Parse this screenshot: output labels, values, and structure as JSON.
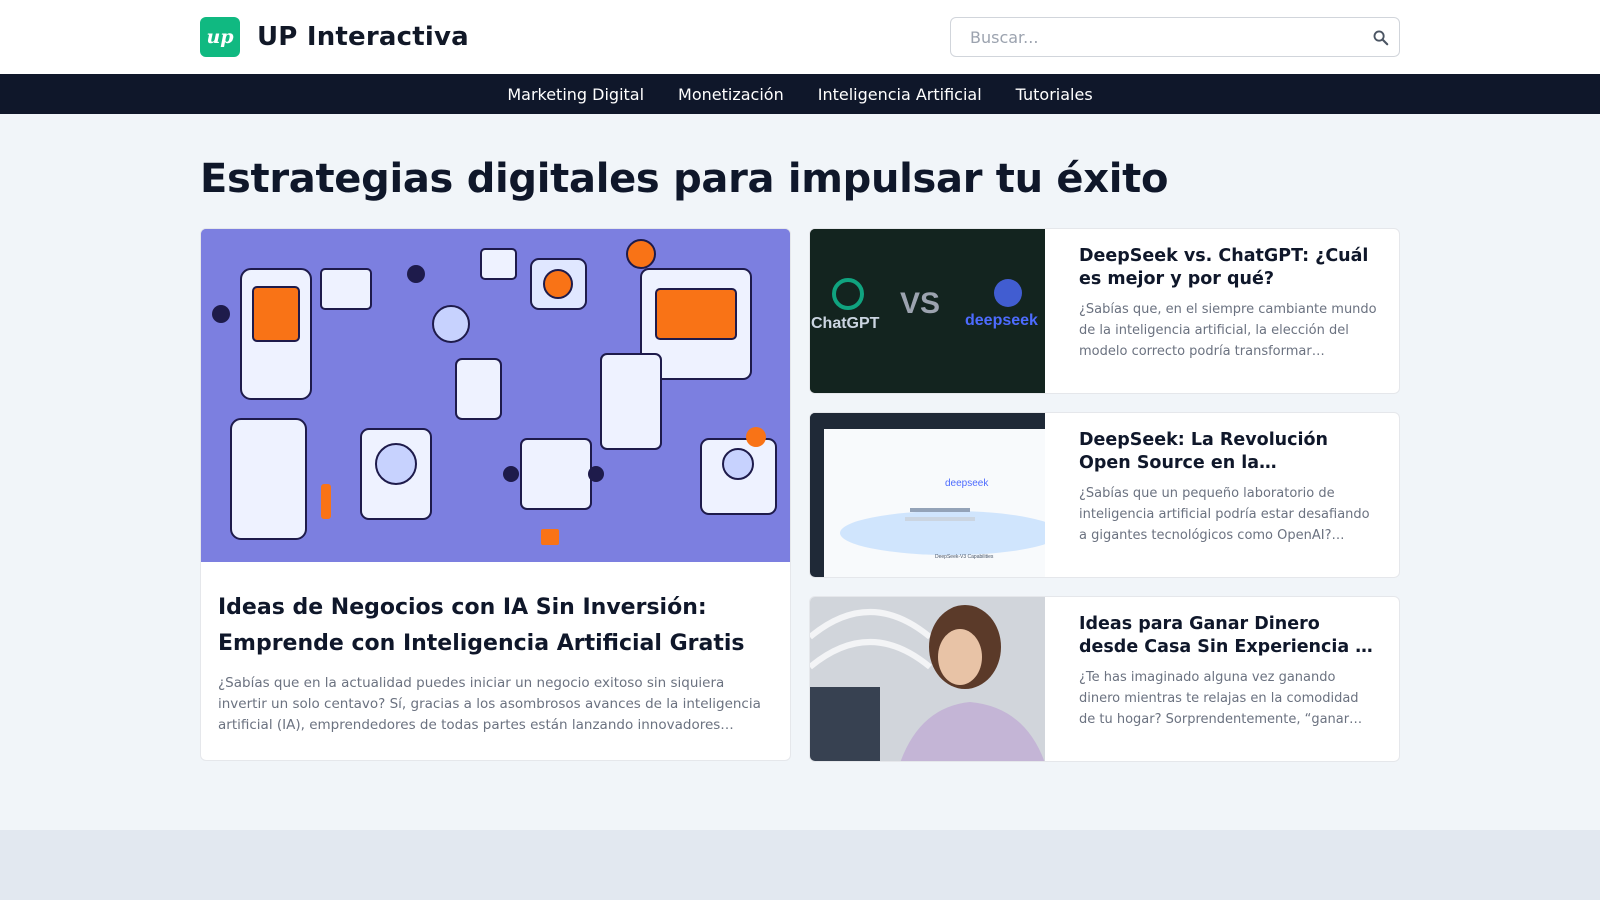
{
  "header": {
    "logo_text": "up",
    "site_name": "UP Interactiva",
    "search": {
      "placeholder": "Buscar...",
      "value": ""
    }
  },
  "nav": {
    "items": [
      {
        "label": "Marketing Digital"
      },
      {
        "label": "Monetización"
      },
      {
        "label": "Inteligencia Artificial"
      },
      {
        "label": "Tutoriales"
      }
    ]
  },
  "main": {
    "title": "Estrategias digitales para impulsar tu éxito",
    "featured": {
      "title": "Ideas de Negocios con IA Sin Inversión: Emprende con Inteligencia Artificial Gratis",
      "excerpt": "¿Sabías que en la actualidad puedes iniciar un negocio exitoso sin siquiera invertir un solo centavo? Sí, gracias a los asombrosos avances de la inteligencia artificial (IA), emprendedores de todas partes están lanzando innovadores negocios con solo su…"
    },
    "side_posts": [
      {
        "title": "DeepSeek vs. ChatGPT: ¿Cuál es mejor y por qué?",
        "excerpt": "¿Sabías que, en el siempre cambiante mundo de la inteligencia artificial, la elección del modelo correcto podría transformar…",
        "thumb_text": {
          "left": "ChatGPT",
          "middle": "VS",
          "right": "deepseek"
        }
      },
      {
        "title": "DeepSeek: La Revolución Open Source en la Inteligencia…",
        "excerpt": "¿Sabías que un pequeño laboratorio de inteligencia artificial podría estar desafiando a gigantes tecnológicos como OpenAI?…",
        "thumb_text": {
          "logo": "deepseek",
          "caption": "DeepSeek-V3 Capabilities"
        }
      },
      {
        "title": "Ideas para Ganar Dinero desde Casa Sin Experiencia y con Poc…",
        "excerpt": "¿Te has imaginado alguna vez ganando dinero mientras te relajas en la comodidad de tu hogar? Sorprendentemente, “ganar dinero…"
      }
    ]
  },
  "colors": {
    "brand": "#10b981",
    "nav_bg": "#0f172a",
    "page_bg": "#f1f5f9",
    "illustration_bg": "#7c7fe0"
  }
}
